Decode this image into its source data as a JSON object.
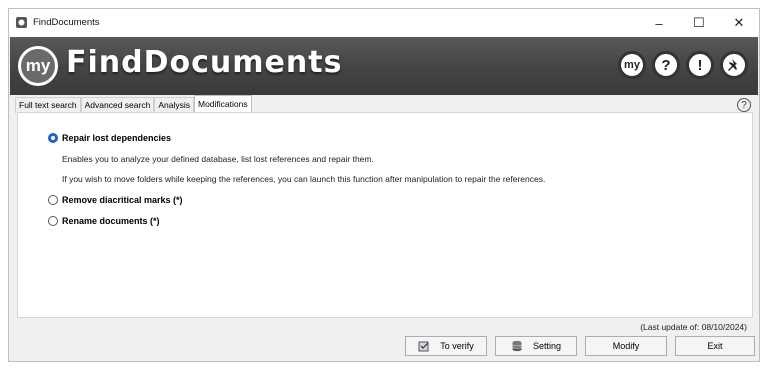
{
  "window": {
    "title": "FindDocuments",
    "minimize": "–",
    "maximize": "☐",
    "close": "✕"
  },
  "banner": {
    "logo": "my",
    "brand": "FindDocuments",
    "my_button": "my",
    "help_button": "?",
    "info_button": "!"
  },
  "tabs": [
    {
      "label": "Full text search"
    },
    {
      "label": "Advanced search"
    },
    {
      "label": "Analysis"
    },
    {
      "label": "Modifications"
    }
  ],
  "help_icon": "?",
  "options": [
    {
      "label": "Repair lost dependencies",
      "checked": true
    },
    {
      "label": "Remove diacritical marks (*)",
      "checked": false
    },
    {
      "label": "Rename documents (*)",
      "checked": false
    }
  ],
  "description": [
    "Enables you to analyze your defined database, list lost references and repair them.",
    "If you wish to move folders while keeping the references, you can launch this function after manipulation to repair the references."
  ],
  "last_update": "(Last update of: 08/10/2024)",
  "buttons": {
    "verify": "To verify",
    "setting": "Setting",
    "modify": "Modify",
    "exit": "Exit"
  },
  "colors": {
    "accent": "#1a64c8",
    "banner": "#4a4a4a"
  }
}
